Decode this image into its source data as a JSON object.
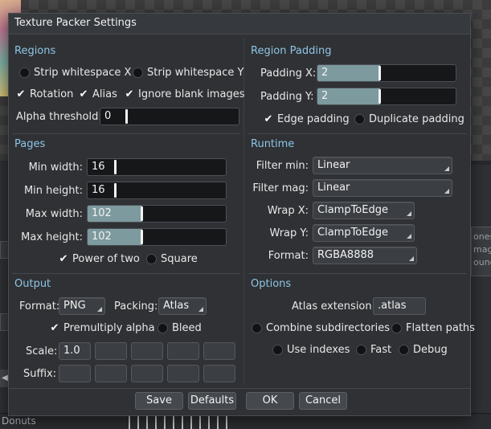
{
  "background": {
    "side_tabs": [
      "",
      ""
    ],
    "right_panel_lines": [
      "ones",
      "mage",
      "ound"
    ],
    "bottom_item": "Donuts"
  },
  "dialog": {
    "title": "Texture Packer Settings",
    "regions": {
      "title": "Regions",
      "strip_x": "Strip whitespace X",
      "strip_y": "Strip whitespace Y",
      "rotation": "Rotation",
      "alias": "Alias",
      "ignore_blank": "Ignore blank images",
      "alpha_label": "Alpha threshold:",
      "alpha_value": "0",
      "checked": {
        "strip_x": false,
        "strip_y": false,
        "rotation": true,
        "alias": true,
        "ignore_blank": true
      }
    },
    "region_padding": {
      "title": "Region Padding",
      "padding_x_label": "Padding X:",
      "padding_x_value": "2",
      "padding_y_label": "Padding Y:",
      "padding_y_value": "2",
      "edge_padding": "Edge padding",
      "duplicate_padding": "Duplicate padding",
      "checked": {
        "edge_padding": true,
        "duplicate_padding": false
      }
    },
    "pages": {
      "title": "Pages",
      "min_width_label": "Min width:",
      "min_width_value": "16",
      "min_height_label": "Min height:",
      "min_height_value": "16",
      "max_width_label": "Max width:",
      "max_width_value": "102",
      "max_height_label": "Max height:",
      "max_height_value": "102",
      "power_of_two": "Power of two",
      "square": "Square",
      "checked": {
        "power_of_two": true,
        "square": false
      }
    },
    "runtime": {
      "title": "Runtime",
      "filter_min_label": "Filter min:",
      "filter_min_value": "Linear",
      "filter_mag_label": "Filter mag:",
      "filter_mag_value": "Linear",
      "wrap_x_label": "Wrap X:",
      "wrap_x_value": "ClampToEdge",
      "wrap_y_label": "Wrap Y:",
      "wrap_y_value": "ClampToEdge",
      "format_label": "Format:",
      "format_value": "RGBA8888"
    },
    "output": {
      "title": "Output",
      "format_label": "Format:",
      "format_value": "PNG",
      "packing_label": "Packing:",
      "packing_value": "Atlas",
      "premultiply": "Premultiply alpha",
      "bleed": "Bleed",
      "scale_label": "Scale:",
      "scale_value": "1.0",
      "suffix_label": "Suffix:",
      "checked": {
        "premultiply": true,
        "bleed": false
      }
    },
    "options": {
      "title": "Options",
      "atlas_ext_label": "Atlas extension:",
      "atlas_ext_value": ".atlas",
      "combine_subdirs": "Combine subdirectories",
      "flatten_paths": "Flatten paths",
      "use_indexes": "Use indexes",
      "fast": "Fast",
      "debug": "Debug",
      "checked": {
        "combine_subdirs": false,
        "flatten_paths": false,
        "use_indexes": false,
        "fast": false,
        "debug": false
      }
    },
    "buttons": {
      "save": "Save",
      "defaults": "Defaults",
      "ok": "OK",
      "cancel": "Cancel"
    }
  }
}
